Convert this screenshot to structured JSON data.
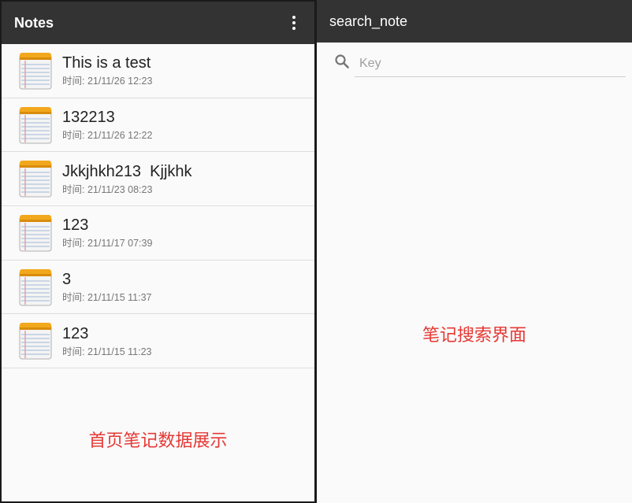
{
  "home": {
    "title": "Notes",
    "menu_icon": "more-vert-icon",
    "notes": [
      {
        "title": "This is a test",
        "time": "时间: 21/11/26 12:23"
      },
      {
        "title": "132213",
        "time": "时间: 21/11/26 12:22"
      },
      {
        "title": "Jkkjhkh213  Kjjkhk",
        "time": "时间: 21/11/23 08:23"
      },
      {
        "title": "123",
        "time": "时间: 21/11/17 07:39"
      },
      {
        "title": "3",
        "time": "时间: 21/11/15 11:37"
      },
      {
        "title": "123",
        "time": "时间: 21/11/15 11:23"
      }
    ],
    "caption": "首页笔记数据展示"
  },
  "search": {
    "title": "search_note",
    "placeholder": "Key",
    "value": "",
    "icon": "search-icon",
    "caption": "笔记搜索界面"
  },
  "colors": {
    "appbar": "#333333",
    "background": "#fafafa",
    "caption": "#e53935",
    "divider": "#dddddd"
  }
}
